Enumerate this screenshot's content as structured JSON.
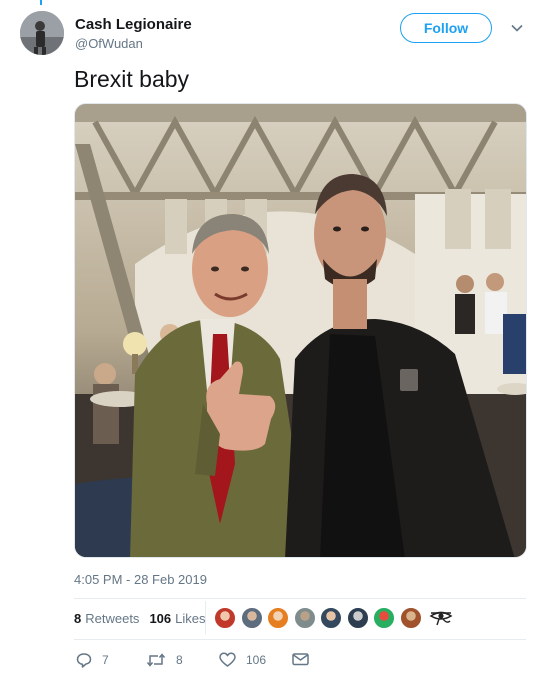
{
  "user": {
    "display_name": "Cash Legionaire",
    "handle": "@OfWudan",
    "avatar_icon": "profile-photo-avatar"
  },
  "header": {
    "follow_label": "Follow",
    "menu_icon": "chevron-down-icon"
  },
  "tweet": {
    "text": "Brexit baby",
    "timestamp": "4:05 PM - 28 Feb 2019",
    "media_icon": "photo-two-men-thumbs-up"
  },
  "stats": {
    "retweets_count": "8",
    "retweets_label": "Retweets",
    "likes_count": "106",
    "likes_label": "Likes",
    "liker_colors": [
      "#c0392b",
      "#5d6d7e",
      "#e67e22",
      "#7f8c8d",
      "#34495e",
      "#2c3e50",
      "#27ae60",
      "#a0522d"
    ],
    "liker_extra_icon": "eye-of-horus-icon"
  },
  "actions": {
    "reply_count": "7",
    "retweet_count": "8",
    "like_count": "106",
    "reply_icon": "reply-icon",
    "retweet_icon": "retweet-icon",
    "like_icon": "heart-icon",
    "dm_icon": "envelope-icon"
  },
  "colors": {
    "accent": "#1da1f2",
    "secondary_text": "#657786",
    "primary_text": "#14171a",
    "divider": "#e6ecf0"
  }
}
